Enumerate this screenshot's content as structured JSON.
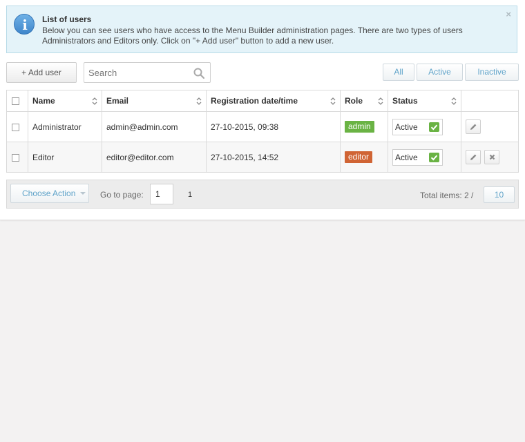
{
  "info": {
    "title": "List of users",
    "text": "Below you can see users who have access to the Menu Builder administration pages. There are two types of users Administrators and Editors only. Click on \"+ Add user\" button to add a new user.",
    "close_symbol": "×"
  },
  "toolbar": {
    "add_label": "+ Add user",
    "search_placeholder": "Search",
    "filters": [
      "All",
      "Active",
      "Inactive"
    ]
  },
  "table": {
    "columns": [
      "Name",
      "Email",
      "Registration date/time",
      "Role",
      "Status"
    ],
    "rows": [
      {
        "name": "Administrator",
        "email": "admin@admin.com",
        "registered": "27-10-2015, 09:38",
        "role": "admin",
        "role_color": "#6ab344",
        "status": "Active",
        "deletable": false
      },
      {
        "name": "Editor",
        "email": "editor@editor.com",
        "registered": "27-10-2015, 14:52",
        "role": "editor",
        "role_color": "#d06434",
        "status": "Active",
        "deletable": true
      }
    ]
  },
  "footer": {
    "choose_action": "Choose Action",
    "goto_label": "Go to page:",
    "goto_value": "1",
    "page_count": "1",
    "total_label": "Total items: 2 /",
    "per_page": "10"
  },
  "colors": {
    "accent": "#5fa3c9",
    "check_green": "#6ab344",
    "info_bg": "#e4f3f9"
  },
  "icons": [
    "info-icon",
    "close-icon",
    "search-icon",
    "sort-icon",
    "checkmark-icon",
    "pencil-icon",
    "delete-icon",
    "chevron-down-icon"
  ]
}
